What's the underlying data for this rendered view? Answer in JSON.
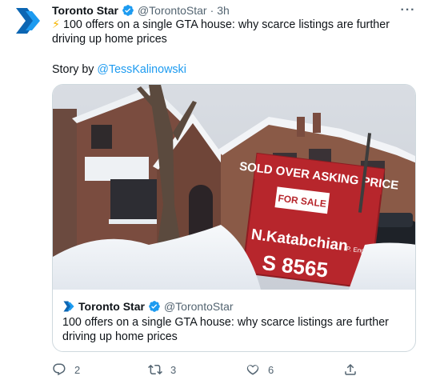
{
  "tweet": {
    "author": {
      "display_name": "Toronto Star",
      "handle": "@TorontoStar",
      "verified": true,
      "separator": "·",
      "time": "3h",
      "avatar_icon": "toronto-star-logo"
    },
    "more_label": "···",
    "text_emoji": "⚡",
    "text": " 100 offers on a single GTA house: why scarce listings are further driving up home prices",
    "story_prefix": "Story by ",
    "story_mention": "@TessKalinowski"
  },
  "card": {
    "image_sign": {
      "line1": "SOLD OVER ASKING PRICE",
      "line2": "FOR SALE",
      "line3": "N.Katabchian",
      "line3b": "P. Eng.",
      "line4": "S 8565"
    },
    "author": {
      "display_name": "Toronto Star",
      "handle": "@TorontoStar",
      "verified": true
    },
    "text": "100 offers on a single GTA house: why scarce listings are further driving up home prices"
  },
  "actions": {
    "reply": {
      "icon": "reply-icon",
      "count": "2"
    },
    "retweet": {
      "icon": "retweet-icon",
      "count": "3"
    },
    "like": {
      "icon": "like-icon",
      "count": "6"
    },
    "share": {
      "icon": "share-icon"
    }
  },
  "colors": {
    "brand_blue": "#1d9bf0",
    "star_blue": "#0c66b3",
    "text": "#0f1419",
    "muted": "#536471",
    "sign_red": "#b7262c"
  }
}
